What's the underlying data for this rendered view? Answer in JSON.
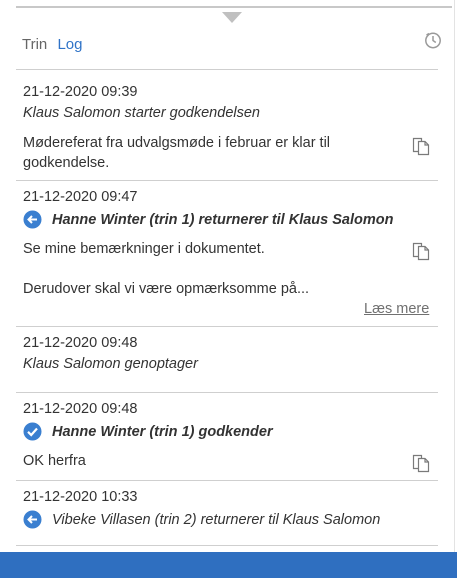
{
  "tabs": [
    {
      "label": "Trin",
      "active": false
    },
    {
      "label": "Log",
      "active": true
    }
  ],
  "icons": {
    "history": "history-clock-icon",
    "document": "document-copy-icon",
    "returned": "return-arrow-icon",
    "approved": "checkmark-circle-icon"
  },
  "colors": {
    "accent": "#2f73c7",
    "status_blue": "#3a7fd0",
    "bottom_bar": "#2f6fc0"
  },
  "log": [
    {
      "timestamp": "21-12-2020 09:39",
      "action": "Klaus Salomon starter godkendelsen",
      "comment_lines": [
        "Mødereferat fra udvalgsmøde i februar er klar til",
        "godkendelse."
      ]
    },
    {
      "timestamp": "21-12-2020 09:47",
      "action": "Hanne Winter (trin 1) returnerer til Klaus Salomon",
      "comment_lines": [
        "Se mine bemærkninger i dokumentet.",
        "",
        "Derudover skal vi være opmærksomme på..."
      ],
      "read_more": "Læs mere"
    },
    {
      "timestamp": "21-12-2020 09:48",
      "action": "Klaus Salomon genoptager"
    },
    {
      "timestamp": "21-12-2020 09:48",
      "action": "Hanne Winter (trin 1) godkender",
      "comment_lines": [
        "OK herfra"
      ]
    },
    {
      "timestamp": "21-12-2020 10:33",
      "action": "Vibeke Villasen (trin 2) returnerer til Klaus Salomon"
    }
  ]
}
